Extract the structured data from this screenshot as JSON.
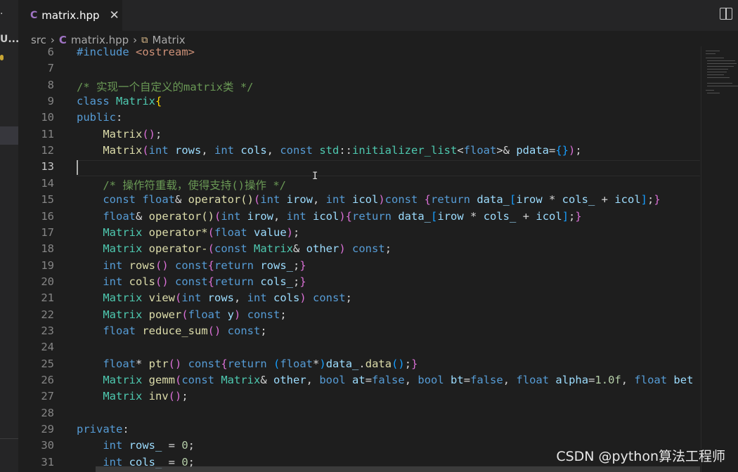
{
  "sidebar": {
    "explorer_fragment": "U...",
    "top_glyph": "·"
  },
  "tab": {
    "icon": "C",
    "name": "matrix.hpp",
    "close": "✕"
  },
  "breadcrumb": {
    "folder": "src",
    "file_icon": "C",
    "file": "matrix.hpp",
    "symbol_icon": "⧉",
    "symbol": "Matrix"
  },
  "editor": {
    "current_line": 13,
    "lines": [
      {
        "num": "6",
        "tokens": [
          [
            "k",
            "#include "
          ],
          [
            "s",
            "<ostream>"
          ]
        ]
      },
      {
        "num": "7",
        "tokens": []
      },
      {
        "num": "8",
        "tokens": [
          [
            "c",
            "/* 实现一个自定义的matrix类 */"
          ]
        ]
      },
      {
        "num": "9",
        "tokens": [
          [
            "k",
            "class "
          ],
          [
            "t",
            "Matrix"
          ],
          [
            "b1",
            "{"
          ]
        ]
      },
      {
        "num": "10",
        "tokens": [
          [
            "k",
            "public"
          ],
          [
            "p",
            ":"
          ]
        ]
      },
      {
        "num": "11",
        "tokens": [
          [
            "p",
            "    "
          ],
          [
            "f",
            "Matrix"
          ],
          [
            "b2",
            "()"
          ],
          [
            "p",
            ";"
          ]
        ]
      },
      {
        "num": "12",
        "tokens": [
          [
            "p",
            "    "
          ],
          [
            "f",
            "Matrix"
          ],
          [
            "b2",
            "("
          ],
          [
            "k",
            "int "
          ],
          [
            "v",
            "rows"
          ],
          [
            "p",
            ", "
          ],
          [
            "k",
            "int "
          ],
          [
            "v",
            "cols"
          ],
          [
            "p",
            ", "
          ],
          [
            "k",
            "const "
          ],
          [
            "t",
            "std"
          ],
          [
            "p",
            "::"
          ],
          [
            "t",
            "initializer_list"
          ],
          [
            "p",
            "<"
          ],
          [
            "k",
            "float"
          ],
          [
            "p",
            ">& "
          ],
          [
            "v",
            "pdata"
          ],
          [
            "p",
            "="
          ],
          [
            "b3",
            "{}"
          ],
          [
            "b2",
            ")"
          ],
          [
            "p",
            ";"
          ]
        ]
      },
      {
        "num": "13",
        "tokens": []
      },
      {
        "num": "14",
        "tokens": [
          [
            "p",
            "    "
          ],
          [
            "c",
            "/* 操作符重载，使得支持()操作 */"
          ]
        ]
      },
      {
        "num": "15",
        "tokens": [
          [
            "p",
            "    "
          ],
          [
            "k",
            "const float"
          ],
          [
            "p",
            "& "
          ],
          [
            "f",
            "operator()"
          ],
          [
            "b2",
            "("
          ],
          [
            "k",
            "int "
          ],
          [
            "v",
            "irow"
          ],
          [
            "p",
            ", "
          ],
          [
            "k",
            "int "
          ],
          [
            "v",
            "icol"
          ],
          [
            "b2",
            ")"
          ],
          [
            "k",
            "const "
          ],
          [
            "b2",
            "{"
          ],
          [
            "k",
            "return "
          ],
          [
            "v",
            "data_"
          ],
          [
            "b3",
            "["
          ],
          [
            "v",
            "irow"
          ],
          [
            "p",
            " * "
          ],
          [
            "v",
            "cols_"
          ],
          [
            "p",
            " + "
          ],
          [
            "v",
            "icol"
          ],
          [
            "b3",
            "]"
          ],
          [
            "p",
            ";"
          ],
          [
            "b2",
            "}"
          ]
        ]
      },
      {
        "num": "16",
        "tokens": [
          [
            "p",
            "    "
          ],
          [
            "k",
            "float"
          ],
          [
            "p",
            "& "
          ],
          [
            "f",
            "operator()"
          ],
          [
            "b2",
            "("
          ],
          [
            "k",
            "int "
          ],
          [
            "v",
            "irow"
          ],
          [
            "p",
            ", "
          ],
          [
            "k",
            "int "
          ],
          [
            "v",
            "icol"
          ],
          [
            "b2",
            ")"
          ],
          [
            "b2",
            "{"
          ],
          [
            "k",
            "return "
          ],
          [
            "v",
            "data_"
          ],
          [
            "b3",
            "["
          ],
          [
            "v",
            "irow"
          ],
          [
            "p",
            " * "
          ],
          [
            "v",
            "cols_"
          ],
          [
            "p",
            " + "
          ],
          [
            "v",
            "icol"
          ],
          [
            "b3",
            "]"
          ],
          [
            "p",
            ";"
          ],
          [
            "b2",
            "}"
          ]
        ]
      },
      {
        "num": "17",
        "tokens": [
          [
            "p",
            "    "
          ],
          [
            "t",
            "Matrix "
          ],
          [
            "f",
            "operator*"
          ],
          [
            "b2",
            "("
          ],
          [
            "k",
            "float "
          ],
          [
            "v",
            "value"
          ],
          [
            "b2",
            ")"
          ],
          [
            "p",
            ";"
          ]
        ]
      },
      {
        "num": "18",
        "tokens": [
          [
            "p",
            "    "
          ],
          [
            "t",
            "Matrix "
          ],
          [
            "f",
            "operator-"
          ],
          [
            "b2",
            "("
          ],
          [
            "k",
            "const "
          ],
          [
            "t",
            "Matrix"
          ],
          [
            "p",
            "& "
          ],
          [
            "v",
            "other"
          ],
          [
            "b2",
            ")"
          ],
          [
            "k",
            " const"
          ],
          [
            "p",
            ";"
          ]
        ]
      },
      {
        "num": "19",
        "tokens": [
          [
            "p",
            "    "
          ],
          [
            "k",
            "int "
          ],
          [
            "f",
            "rows"
          ],
          [
            "b2",
            "()"
          ],
          [
            "k",
            " const"
          ],
          [
            "b2",
            "{"
          ],
          [
            "k",
            "return "
          ],
          [
            "v",
            "rows_"
          ],
          [
            "p",
            ";"
          ],
          [
            "b2",
            "}"
          ]
        ]
      },
      {
        "num": "20",
        "tokens": [
          [
            "p",
            "    "
          ],
          [
            "k",
            "int "
          ],
          [
            "f",
            "cols"
          ],
          [
            "b2",
            "()"
          ],
          [
            "k",
            " const"
          ],
          [
            "b2",
            "{"
          ],
          [
            "k",
            "return "
          ],
          [
            "v",
            "cols_"
          ],
          [
            "p",
            ";"
          ],
          [
            "b2",
            "}"
          ]
        ]
      },
      {
        "num": "21",
        "tokens": [
          [
            "p",
            "    "
          ],
          [
            "t",
            "Matrix "
          ],
          [
            "f",
            "view"
          ],
          [
            "b2",
            "("
          ],
          [
            "k",
            "int "
          ],
          [
            "v",
            "rows"
          ],
          [
            "p",
            ", "
          ],
          [
            "k",
            "int "
          ],
          [
            "v",
            "cols"
          ],
          [
            "b2",
            ")"
          ],
          [
            "k",
            " const"
          ],
          [
            "p",
            ";"
          ]
        ]
      },
      {
        "num": "22",
        "tokens": [
          [
            "p",
            "    "
          ],
          [
            "t",
            "Matrix "
          ],
          [
            "f",
            "power"
          ],
          [
            "b2",
            "("
          ],
          [
            "k",
            "float "
          ],
          [
            "v",
            "y"
          ],
          [
            "b2",
            ")"
          ],
          [
            "k",
            " const"
          ],
          [
            "p",
            ";"
          ]
        ]
      },
      {
        "num": "23",
        "tokens": [
          [
            "p",
            "    "
          ],
          [
            "k",
            "float "
          ],
          [
            "f",
            "reduce_sum"
          ],
          [
            "b2",
            "()"
          ],
          [
            "k",
            " const"
          ],
          [
            "p",
            ";"
          ]
        ]
      },
      {
        "num": "24",
        "tokens": []
      },
      {
        "num": "25",
        "tokens": [
          [
            "p",
            "    "
          ],
          [
            "k",
            "float"
          ],
          [
            "p",
            "* "
          ],
          [
            "f",
            "ptr"
          ],
          [
            "b2",
            "()"
          ],
          [
            "k",
            " const"
          ],
          [
            "b2",
            "{"
          ],
          [
            "k",
            "return "
          ],
          [
            "b3",
            "("
          ],
          [
            "k",
            "float"
          ],
          [
            "p",
            "*"
          ],
          [
            "b3",
            ")"
          ],
          [
            "v",
            "data_"
          ],
          [
            "p",
            "."
          ],
          [
            "f",
            "data"
          ],
          [
            "b3",
            "()"
          ],
          [
            "p",
            ";"
          ],
          [
            "b2",
            "}"
          ]
        ]
      },
      {
        "num": "26",
        "tokens": [
          [
            "p",
            "    "
          ],
          [
            "t",
            "Matrix "
          ],
          [
            "f",
            "gemm"
          ],
          [
            "b2",
            "("
          ],
          [
            "k",
            "const "
          ],
          [
            "t",
            "Matrix"
          ],
          [
            "p",
            "& "
          ],
          [
            "v",
            "other"
          ],
          [
            "p",
            ", "
          ],
          [
            "k",
            "bool "
          ],
          [
            "v",
            "at"
          ],
          [
            "p",
            "="
          ],
          [
            "k",
            "false"
          ],
          [
            "p",
            ", "
          ],
          [
            "k",
            "bool "
          ],
          [
            "v",
            "bt"
          ],
          [
            "p",
            "="
          ],
          [
            "k",
            "false"
          ],
          [
            "p",
            ", "
          ],
          [
            "k",
            "float "
          ],
          [
            "v",
            "alpha"
          ],
          [
            "p",
            "="
          ],
          [
            "n",
            "1.0f"
          ],
          [
            "p",
            ", "
          ],
          [
            "k",
            "float "
          ],
          [
            "v",
            "bet"
          ]
        ]
      },
      {
        "num": "27",
        "tokens": [
          [
            "p",
            "    "
          ],
          [
            "t",
            "Matrix "
          ],
          [
            "f",
            "inv"
          ],
          [
            "b2",
            "()"
          ],
          [
            "p",
            ";"
          ]
        ]
      },
      {
        "num": "28",
        "tokens": []
      },
      {
        "num": "29",
        "tokens": [
          [
            "k",
            "private"
          ],
          [
            "p",
            ":"
          ]
        ]
      },
      {
        "num": "30",
        "tokens": [
          [
            "p",
            "    "
          ],
          [
            "k",
            "int "
          ],
          [
            "v",
            "rows_"
          ],
          [
            "p",
            " = "
          ],
          [
            "n",
            "0"
          ],
          [
            "p",
            ";"
          ]
        ]
      },
      {
        "num": "31",
        "tokens": [
          [
            "p",
            "    "
          ],
          [
            "k",
            "int "
          ],
          [
            "v",
            "cols_"
          ],
          [
            "p",
            " = "
          ],
          [
            "n",
            "0"
          ],
          [
            "p",
            ";"
          ]
        ]
      }
    ]
  },
  "watermark": "CSDN @python算法工程师",
  "colors": {
    "keyword": "#569cd6",
    "type": "#4ec9b0",
    "function": "#dcdcaa",
    "variable": "#9cdcfe",
    "comment": "#6a9955",
    "string": "#ce9178",
    "number": "#b5cea8"
  }
}
